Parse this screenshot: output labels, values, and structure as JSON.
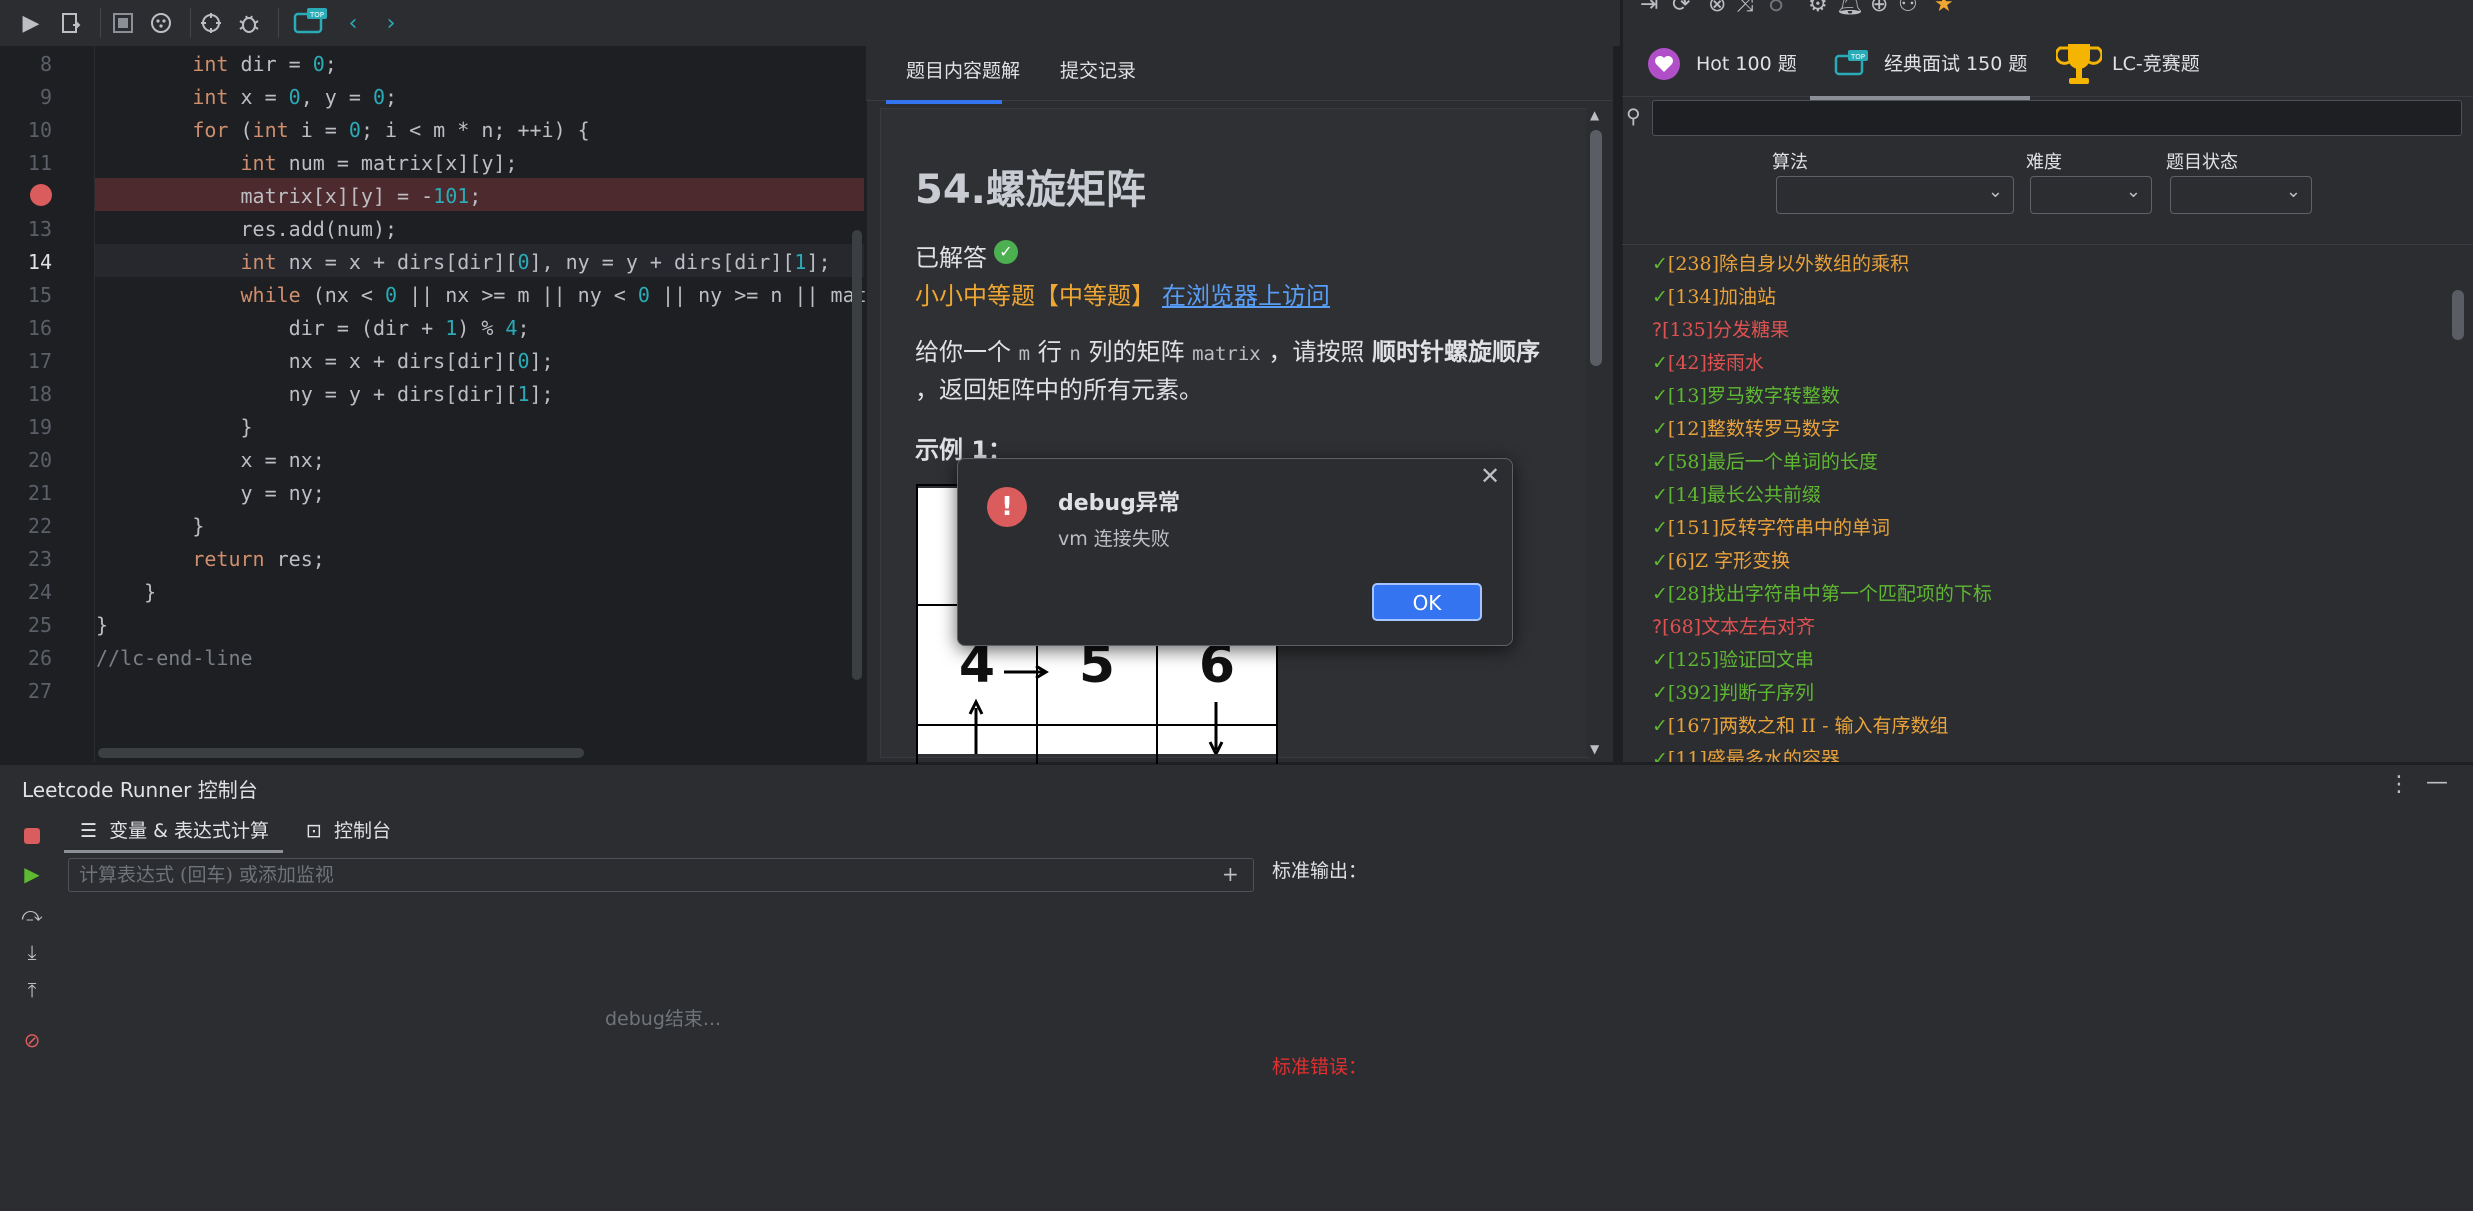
{
  "toolbar": {
    "icons": [
      "run-icon",
      "submit-icon",
      "stop-icon",
      "debug-settings-icon",
      "target-icon",
      "bug-icon",
      "top-icon",
      "back-icon",
      "forward-icon"
    ],
    "top_badge": "TOP"
  },
  "editor": {
    "lines": [
      {
        "n": "8",
        "code": "        <span class=\"kw\">int</span> dir = <span class=\"num\">0</span>;"
      },
      {
        "n": "9",
        "code": "        <span class=\"kw\">int</span> x = <span class=\"num\">0</span>, y = <span class=\"num\">0</span>;"
      },
      {
        "n": "10",
        "code": "        <span class=\"kw\">for</span> (<span class=\"kw\">int</span> i = <span class=\"num\">0</span>; i &lt; m * n; ++i) {"
      },
      {
        "n": "11",
        "code": "            <span class=\"kw\">int</span> num = matrix[x][y];"
      },
      {
        "n": "12",
        "code": "            matrix[x][y] = -<span class=\"num\">101</span>;"
      },
      {
        "n": "13",
        "code": "            res.add(num);"
      },
      {
        "n": "14",
        "code": "            <span class=\"kw\">int</span> nx = x + dirs[dir][<span class=\"num\">0</span>], ny = y + dirs[dir][<span class=\"num\">1</span>];"
      },
      {
        "n": "15",
        "code": "            <span class=\"kw\">while</span> (nx &lt; <span class=\"num\">0</span> || nx &gt;= m || ny &lt; <span class=\"num\">0</span> || ny &gt;= n || mat"
      },
      {
        "n": "16",
        "code": "                dir = (dir + <span class=\"num\">1</span>) % <span class=\"num\">4</span>;"
      },
      {
        "n": "17",
        "code": "                nx = x + dirs[dir][<span class=\"num\">0</span>];"
      },
      {
        "n": "18",
        "code": "                ny = y + dirs[dir][<span class=\"num\">1</span>];"
      },
      {
        "n": "19",
        "code": "            }"
      },
      {
        "n": "20",
        "code": "            x = nx;"
      },
      {
        "n": "21",
        "code": "            y = ny;"
      },
      {
        "n": "22",
        "code": "        }"
      },
      {
        "n": "23",
        "code": "        <span class=\"kw\">return</span> res;"
      },
      {
        "n": "24",
        "code": "    }"
      },
      {
        "n": "25",
        "code": "}"
      },
      {
        "n": "26",
        "code": "<span class=\"cm\">//lc-end-line</span>"
      },
      {
        "n": "27",
        "code": ""
      }
    ],
    "breakpoint_line": "12",
    "current_line": "14"
  },
  "problem": {
    "tabs": [
      "题目内容",
      "题解",
      "提交记录"
    ],
    "active_tab": 0,
    "title": "54.螺旋矩阵",
    "status": "已解答",
    "difficulty": "小小中等题【中等题】",
    "browser_link": "在浏览器上访问",
    "desc_p1": "给你一个 ",
    "desc_m": "m",
    "desc_p2": " 行 ",
    "desc_n": "n",
    "desc_p3": " 列的矩阵 ",
    "desc_matrix": "matrix",
    "desc_p4": " ，请按照 ",
    "desc_bold": "顺时针螺旋顺序",
    "desc_p5": " ，返回矩阵中的所有元素。",
    "example_title": "示例 1：",
    "matrix_values": [
      "4",
      "5",
      "6"
    ]
  },
  "right": {
    "toolbar_icons": [
      "login-icon",
      "refresh-icon",
      "close-circle-icon",
      "shuffle-icon",
      "status-icon",
      "gear-icon",
      "bell-icon",
      "target-icon",
      "network-icon",
      "star-icon"
    ],
    "tabs": [
      {
        "label": "Hot 100 题",
        "icon": "heart-icon"
      },
      {
        "label": "经典面试 150 题",
        "icon": "top-icon"
      },
      {
        "label": "LC-竞赛题",
        "icon": "trophy-icon"
      }
    ],
    "active_tab": 1,
    "search_placeholder": "",
    "filters": [
      {
        "label": "算法",
        "value": ""
      },
      {
        "label": "难度",
        "value": ""
      },
      {
        "label": "题目状态",
        "value": ""
      }
    ],
    "questions": [
      {
        "mark": "✓",
        "text": "[238]除自身以外数组的乘积",
        "color": "#e9a23b"
      },
      {
        "mark": "✓",
        "text": "[134]加油站",
        "color": "#e9a23b"
      },
      {
        "mark": "?",
        "text": "[135]分发糖果",
        "color": "#e05252"
      },
      {
        "mark": "✓",
        "text": "[42]接雨水",
        "color": "#e05252"
      },
      {
        "mark": "✓",
        "text": "[13]罗马数字转整数",
        "color": "#5fb832"
      },
      {
        "mark": "✓",
        "text": "[12]整数转罗马数字",
        "color": "#e9a23b"
      },
      {
        "mark": "✓",
        "text": "[58]最后一个单词的长度",
        "color": "#5fb832"
      },
      {
        "mark": "✓",
        "text": "[14]最长公共前缀",
        "color": "#5fb832"
      },
      {
        "mark": "✓",
        "text": "[151]反转字符串中的单词",
        "color": "#e9a23b"
      },
      {
        "mark": "✓",
        "text": "[6]Z 字形变换",
        "color": "#e9a23b"
      },
      {
        "mark": "✓",
        "text": "[28]找出字符串中第一个匹配项的下标",
        "color": "#5fb832"
      },
      {
        "mark": "?",
        "text": "[68]文本左右对齐",
        "color": "#e05252"
      },
      {
        "mark": "✓",
        "text": "[125]验证回文串",
        "color": "#5fb832"
      },
      {
        "mark": "✓",
        "text": "[392]判断子序列",
        "color": "#5fb832"
      },
      {
        "mark": "✓",
        "text": "[167]两数之和 II - 输入有序数组",
        "color": "#e9a23b"
      },
      {
        "mark": "✓",
        "text": "[11]盛最多水的容器",
        "color": "#e9a23b"
      }
    ]
  },
  "console": {
    "title": "Leetcode Runner 控制台",
    "tabs": [
      "变量 & 表达式计算",
      "控制台"
    ],
    "expr_placeholder": "计算表达式 (回车) 或添加监视",
    "debug_end": "debug结束...",
    "stdout_label": "标准输出：",
    "stderr_label": "标准错误："
  },
  "dialog": {
    "title": "debug异常",
    "message": "vm 连接失败",
    "ok_label": "OK"
  },
  "colors": {
    "accent": "#3574f0",
    "breakpoint": "#db5c5c",
    "success": "#5fb832",
    "medium": "#f0a732",
    "link": "#589df6"
  }
}
